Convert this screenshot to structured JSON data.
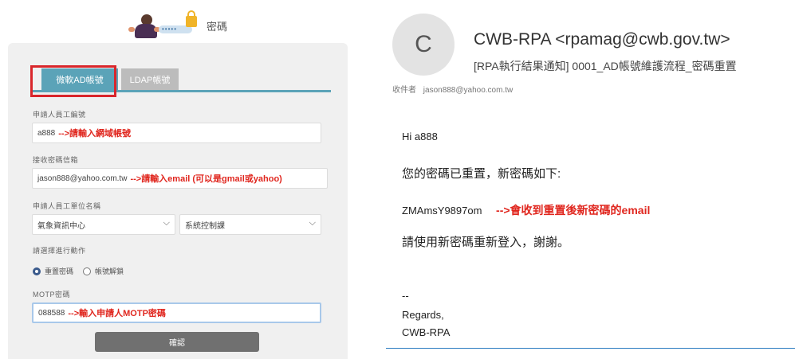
{
  "form": {
    "header_title": "密碼",
    "tabs": [
      {
        "label": "微軟AD帳號",
        "active": true
      },
      {
        "label": "LDAP帳號",
        "active": false
      }
    ],
    "employee_id": {
      "label": "申請人員工編號",
      "value": "a888",
      "annotation": "-->請輸入網域帳號"
    },
    "email": {
      "label": "接收密碼信箱",
      "value": "jason888@yahoo.com.tw",
      "annotation": "-->請輸入email (可以是gmail或yahoo)"
    },
    "unit": {
      "label": "申請人員工單位名稱",
      "dept_value": "氣象資訊中心",
      "section_value": "系統控制課"
    },
    "action": {
      "label": "請選擇進行動作",
      "options": [
        {
          "label": "重置密碼",
          "checked": true
        },
        {
          "label": "帳號解鎖",
          "checked": false
        }
      ]
    },
    "motp": {
      "label": "MOTP密碼",
      "value": "088588",
      "annotation": "-->輸入申請人MOTP密碼"
    },
    "submit_label": "確認",
    "accent_color": "#5ba3b8",
    "highlight_color": "#d9262b"
  },
  "email": {
    "avatar_letter": "C",
    "sender": "CWB-RPA <rpamag@cwb.gov.tw>",
    "subject": "[RPA執行結果通知] 0001_AD帳號維護流程_密碼重置",
    "to_label": "收件者",
    "to_value": "jason888@yahoo.com.tw",
    "greeting": "Hi  a888",
    "line1": "您的密碼已重置，新密碼如下:",
    "password": "ZMAmsY9897om",
    "password_annotation": "-->會收到重置後新密碼的email",
    "line2": "請使用新密碼重新登入，謝謝。",
    "sig_dash": "--",
    "sig_regards": "Regards,",
    "sig_name": "CWB-RPA"
  }
}
